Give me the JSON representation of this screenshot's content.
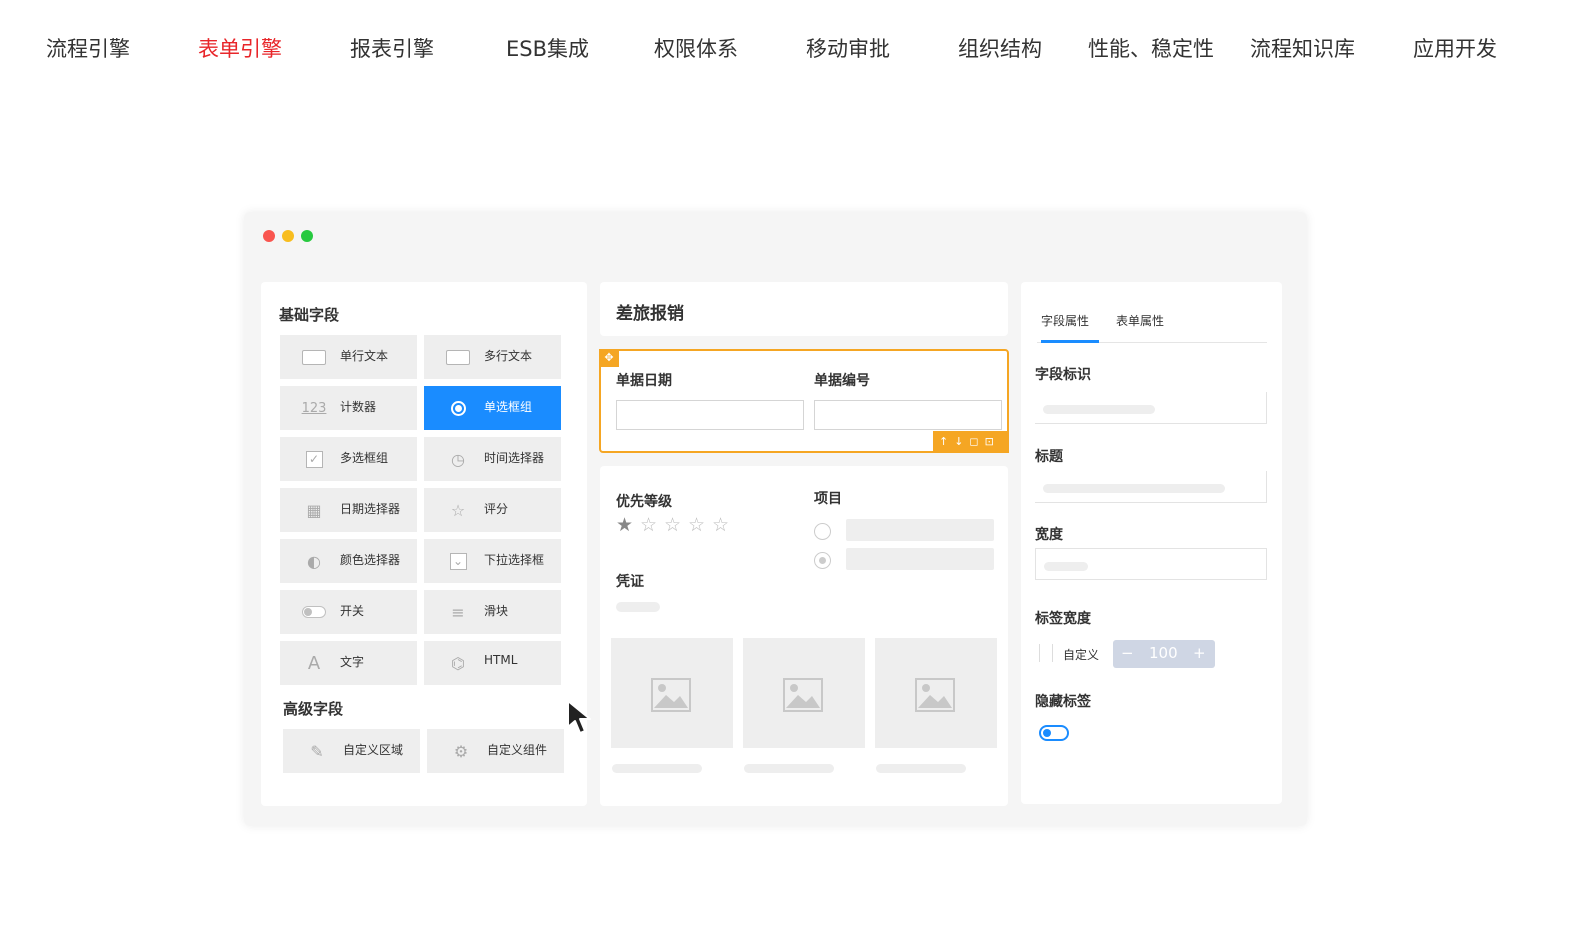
{
  "nav": {
    "items": [
      "流程引擎",
      "表单引擎",
      "报表引擎",
      "ESB集成",
      "权限体系",
      "移动审批",
      "组织结构",
      "性能、稳定性",
      "流程知识库",
      "应用开发"
    ],
    "active_index": 1,
    "active_color": "#e8262a"
  },
  "left_panel": {
    "basic_title": "基础字段",
    "basic_fields": [
      {
        "label": "单行文本",
        "icon": "single-line-text-icon"
      },
      {
        "label": "多行文本",
        "icon": "multi-line-text-icon"
      },
      {
        "label": "计数器",
        "icon": "counter-icon",
        "glyph": "123"
      },
      {
        "label": "单选框组",
        "icon": "radio-group-icon",
        "selected": true
      },
      {
        "label": "多选框组",
        "icon": "checkbox-group-icon",
        "glyph": "✓"
      },
      {
        "label": "时间选择器",
        "icon": "clock-icon",
        "glyph": "◷"
      },
      {
        "label": "日期选择器",
        "icon": "calendar-icon",
        "glyph": "▦"
      },
      {
        "label": "评分",
        "icon": "star-icon",
        "glyph": "☆"
      },
      {
        "label": "颜色选择器",
        "icon": "palette-icon",
        "glyph": "◐"
      },
      {
        "label": "下拉选择框",
        "icon": "dropdown-icon",
        "glyph": "⌄"
      },
      {
        "label": "开关",
        "icon": "toggle-icon"
      },
      {
        "label": "滑块",
        "icon": "slider-icon",
        "glyph": "≡"
      },
      {
        "label": "文字",
        "icon": "text-icon",
        "glyph": "A"
      },
      {
        "label": "HTML",
        "icon": "html-icon",
        "glyph": "⌬"
      }
    ],
    "advanced_title": "高级字段",
    "advanced_fields": [
      {
        "label": "自定义区域",
        "icon": "custom-area-icon",
        "glyph": "✎"
      },
      {
        "label": "自定义组件",
        "icon": "custom-component-icon",
        "glyph": "⚙"
      }
    ]
  },
  "form": {
    "title": "差旅报销",
    "date_label": "单据日期",
    "number_label": "单据编号",
    "priority_label": "优先等级",
    "rating": 1,
    "rating_max": 5,
    "project_label": "项目",
    "voucher_label": "凭证",
    "move_glyph": "✥",
    "toolbar_glyphs": "↑↓◻⊡"
  },
  "props": {
    "tabs": [
      "字段属性",
      "表单属性"
    ],
    "active_tab": 0,
    "field_id_label": "字段标识",
    "title_label": "标题",
    "width_label": "宽度",
    "label_width_label": "标签宽度",
    "custom_label": "自定义",
    "stepper_value": "100",
    "minus": "−",
    "plus": "+",
    "hide_label_label": "隐藏标签",
    "accent": "#1a8cff"
  }
}
